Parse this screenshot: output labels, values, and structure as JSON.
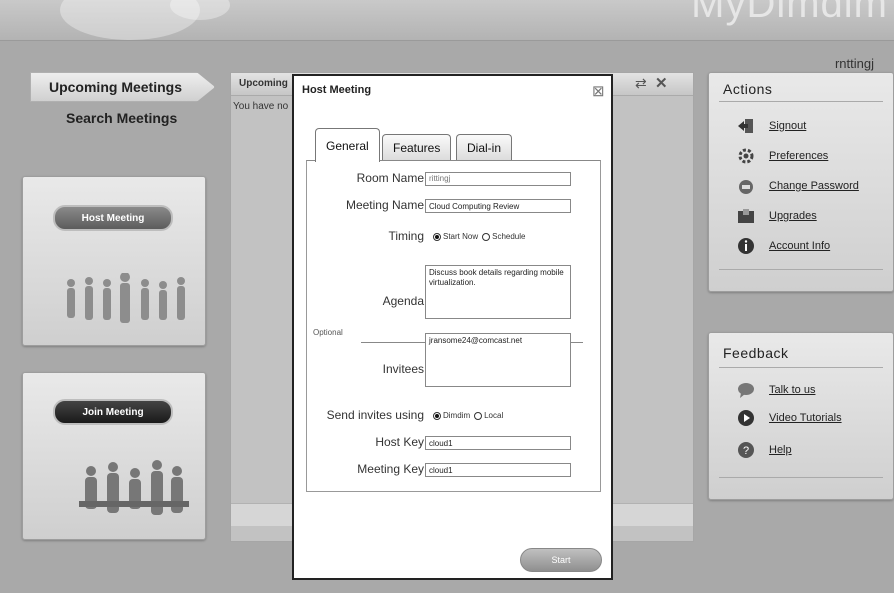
{
  "header": {
    "brand": "MyDimdim",
    "user": "rnttingj"
  },
  "nav": {
    "upcoming": "Upcoming Meetings",
    "search": "Search Meetings"
  },
  "cards": {
    "host_label": "Host Meeting",
    "join_label": "Join Meeting"
  },
  "main": {
    "title": "Upcoming",
    "message": "You have no"
  },
  "actions": {
    "title": "Actions",
    "items": [
      {
        "label": "Signout",
        "icon": "signout-icon"
      },
      {
        "label": "Preferences",
        "icon": "gear-icon"
      },
      {
        "label": "Change Password",
        "icon": "password-icon"
      },
      {
        "label": "Upgrades",
        "icon": "upgrade-icon"
      },
      {
        "label": "Account Info",
        "icon": "info-icon"
      }
    ]
  },
  "feedback": {
    "title": "Feedback",
    "items": [
      {
        "label": "Talk to us",
        "icon": "chat-icon"
      },
      {
        "label": "Video Tutorials",
        "icon": "play-icon"
      },
      {
        "label": "Help",
        "icon": "help-icon"
      }
    ]
  },
  "modal": {
    "title": "Host Meeting",
    "tabs": [
      "General",
      "Features",
      "Dial-in"
    ],
    "fields": {
      "room_name": {
        "label": "Room Name",
        "placeholder": "rittingj"
      },
      "meeting_name": {
        "label": "Meeting Name",
        "value": "Cloud Computing Review"
      },
      "timing": {
        "label": "Timing",
        "options": [
          "Start Now",
          "Schedule"
        ],
        "selected": "Start Now"
      },
      "optional": "Optional",
      "agenda": {
        "label": "Agenda",
        "value": "Discuss book details regarding mobile virtualization."
      },
      "invitees": {
        "label": "Invitees",
        "value": "jransome24@comcast.net"
      },
      "send_invites": {
        "label": "Send invites using",
        "options": [
          "Dimdim",
          "Local"
        ],
        "selected": "Dimdim"
      },
      "host_key": {
        "label": "Host Key",
        "value": "cloud1"
      },
      "meeting_key": {
        "label": "Meeting Key",
        "value": "cloud1"
      }
    },
    "start_label": "Start"
  }
}
